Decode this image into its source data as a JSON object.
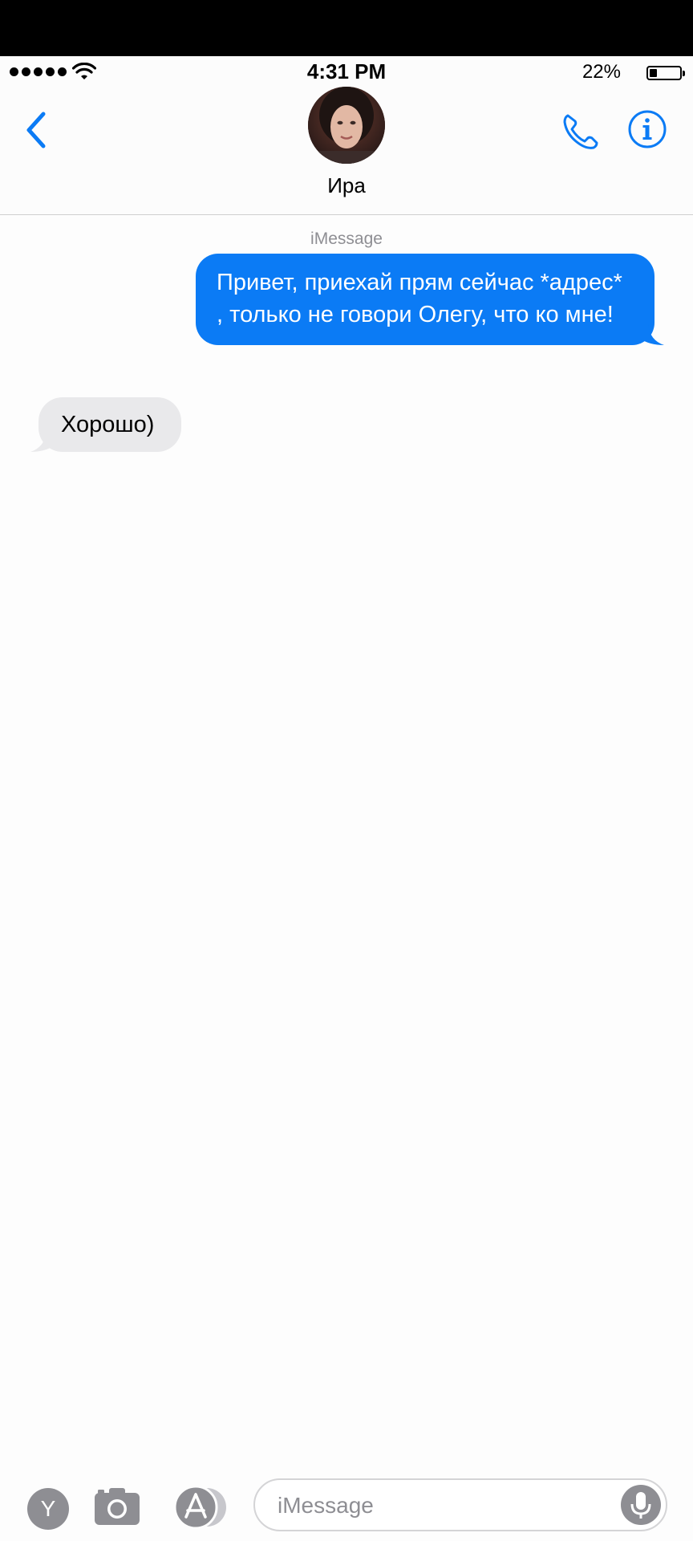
{
  "status_bar": {
    "time": "4:31 PM",
    "battery_percent": "22%",
    "battery_level": 0.22,
    "signal_dots": 5
  },
  "nav": {
    "contact_name": "Ира",
    "back_icon": "chevron-left-icon",
    "call_icon": "phone-icon",
    "info_icon": "info-icon"
  },
  "conversation": {
    "service_label": "iMessage",
    "messages": [
      {
        "direction": "outgoing",
        "text": "Привет, приехай прям сейчас *адрес* , только не говори Олегу, что ко мне!"
      },
      {
        "direction": "incoming",
        "text": "Хорошо)"
      }
    ]
  },
  "bottom_bar": {
    "y_button_label": "Y",
    "input_placeholder": "iMessage",
    "camera_icon": "camera-icon",
    "apps_icon": "app-store-icon",
    "mic_icon": "microphone-icon"
  },
  "colors": {
    "accent": "#0b7bf5",
    "incoming_bubble": "#e9e9eb",
    "secondary_text": "#8e8e93"
  }
}
